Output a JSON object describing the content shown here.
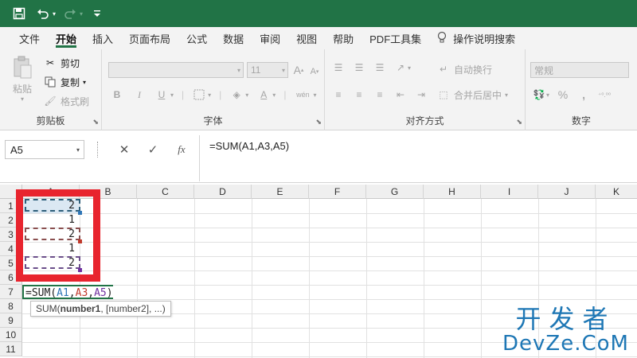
{
  "quick_access": {
    "icons": [
      "save-icon",
      "undo-icon",
      "redo-icon",
      "customize-icon"
    ],
    "undo_dropdown": "▾",
    "redo_dropdown": "▾"
  },
  "tabs": [
    "文件",
    "开始",
    "插入",
    "页面布局",
    "公式",
    "数据",
    "审阅",
    "视图",
    "帮助",
    "PDF工具集"
  ],
  "active_tab": "开始",
  "tell_me": "操作说明搜索",
  "ribbon": {
    "clipboard": {
      "paste_label": "粘贴",
      "cut_label": "剪切",
      "copy_label": "复制",
      "format_painter_label": "格式刷",
      "group_label": "剪贴板"
    },
    "font": {
      "font_size": "11",
      "bold": "B",
      "italic": "I",
      "underline": "U",
      "phonetic": "wén",
      "group_label": "字体"
    },
    "alignment": {
      "wrap_text": "自动换行",
      "merge_center": "合并后居中",
      "group_label": "对齐方式"
    },
    "number": {
      "format": "常规",
      "percent": "%",
      "comma": ",",
      "group_label": "数字"
    }
  },
  "formula_bar": {
    "name_box": "A5",
    "cancel": "✕",
    "enter": "✓",
    "fx": "fx",
    "content": "=SUM(A1,A3,A5)"
  },
  "grid": {
    "columns": [
      "A",
      "B",
      "C",
      "D",
      "E",
      "F",
      "G",
      "H",
      "I",
      "J",
      "K"
    ],
    "rows": [
      "1",
      "2",
      "3",
      "4",
      "5",
      "6",
      "7",
      "8",
      "9",
      "10",
      "11"
    ],
    "cells_a": [
      "2",
      "1",
      "2",
      "1",
      "2"
    ],
    "editing_formula": {
      "prefix": "=SUM(",
      "ref1": "A1",
      "sep1": ",",
      "ref2": "A3",
      "sep2": ",",
      "ref3": "A5",
      "suffix": ")"
    },
    "tooltip": {
      "func": "SUM(",
      "arg1": "number1",
      "rest": ", [number2], ...)"
    }
  },
  "colors": {
    "accent": "#217346",
    "ref1": "#2e75b6",
    "ref2": "#c0392b",
    "ref3": "#7030a0",
    "highlight_box": "#e8242e",
    "watermark": "#1e77b5"
  },
  "watermark": {
    "cn": "开发者",
    "en": "DevZe.CoM"
  }
}
